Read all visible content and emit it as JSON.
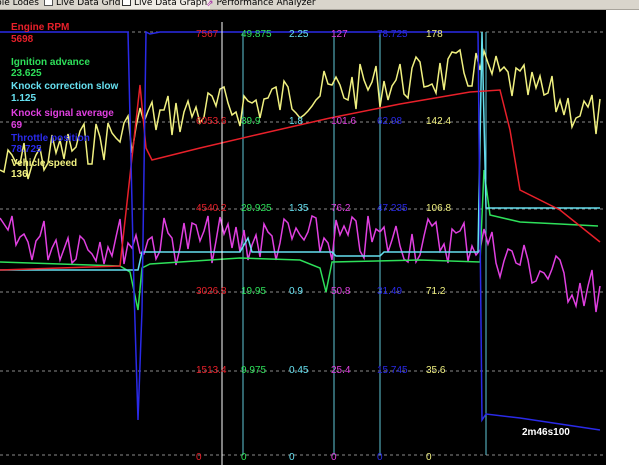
{
  "tabs": [
    {
      "label": "ble Lodes",
      "icon": "document-icon"
    },
    {
      "label": "Live Data Grid",
      "icon": "grid-icon"
    },
    {
      "label": "Live Data Graph",
      "icon": "graph-icon",
      "active": true
    },
    {
      "label": "Performance Analyzer",
      "icon": "performance-icon"
    }
  ],
  "series": [
    {
      "key": "rpm",
      "name": "Engine RPM",
      "value": "5698",
      "color": "#e8202a",
      "scale": [
        "7567",
        "6053.6",
        "4540.2",
        "3026.8",
        "1513.4",
        "0"
      ]
    },
    {
      "key": "ign",
      "name": "Ignition advance",
      "value": "23.625",
      "color": "#2ee05a",
      "scale": [
        "49.875",
        "39.9",
        "29.925",
        "19.95",
        "9.975",
        "0"
      ]
    },
    {
      "key": "knockc",
      "name": "Knock correction slow",
      "value": "1.125",
      "color": "#66e0f0",
      "scale": [
        "2.25",
        "1.8",
        "1.35",
        "0.9",
        "0.45",
        "0"
      ]
    },
    {
      "key": "knocks",
      "name": "Knock signal average",
      "value": "69",
      "color": "#e040e0",
      "scale": [
        "127",
        "101.6",
        "76.2",
        "50.8",
        "25.4",
        "0"
      ]
    },
    {
      "key": "throttle",
      "name": "Throttle position",
      "value": "78.725",
      "color": "#2a2ae8",
      "scale": [
        "78.725",
        "62.98",
        "47.235",
        "31.49",
        "15.745",
        "0"
      ]
    },
    {
      "key": "speed",
      "name": "Vehicle speed",
      "value": "136",
      "color": "#f0f080",
      "scale": [
        "178",
        "142.4",
        "106.8",
        "71.2",
        "35.6",
        "0"
      ]
    }
  ],
  "timestamp": "2m46s100",
  "colors": {
    "background": "#000000",
    "grid": "#8a8a8a",
    "cursor": "#ffffff"
  }
}
